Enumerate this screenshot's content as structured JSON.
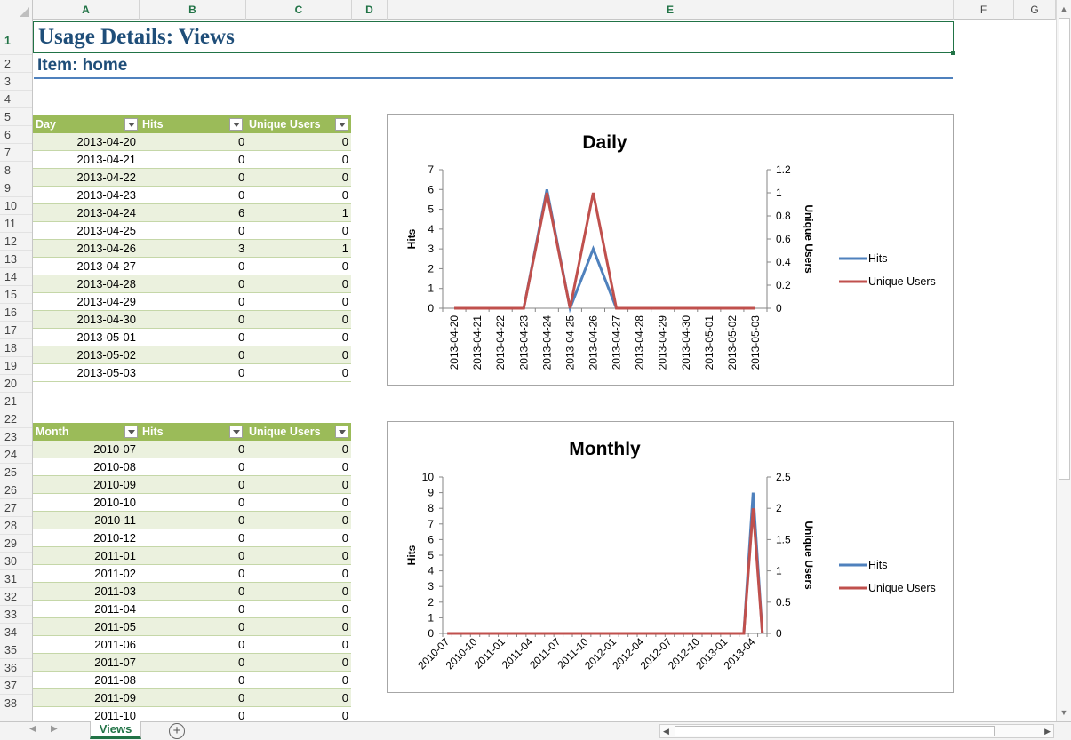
{
  "column_headers": [
    "A",
    "B",
    "C",
    "D",
    "E",
    "F",
    "G"
  ],
  "row_numbers": [
    "1",
    "2",
    "3",
    "4",
    "5",
    "6",
    "7",
    "8",
    "9",
    "10",
    "11",
    "12",
    "13",
    "14",
    "15",
    "16",
    "17",
    "18",
    "19",
    "20",
    "21",
    "22",
    "23",
    "24",
    "25",
    "26",
    "27",
    "28",
    "29",
    "30",
    "31",
    "32",
    "33",
    "34",
    "35",
    "36",
    "37",
    "38"
  ],
  "title": "Usage Details: Views",
  "item": "Item: home",
  "daily_table": {
    "headers": [
      "Day",
      "Hits",
      "Unique Users"
    ],
    "rows": [
      [
        "2013-04-20",
        "0",
        "0"
      ],
      [
        "2013-04-21",
        "0",
        "0"
      ],
      [
        "2013-04-22",
        "0",
        "0"
      ],
      [
        "2013-04-23",
        "0",
        "0"
      ],
      [
        "2013-04-24",
        "6",
        "1"
      ],
      [
        "2013-04-25",
        "0",
        "0"
      ],
      [
        "2013-04-26",
        "3",
        "1"
      ],
      [
        "2013-04-27",
        "0",
        "0"
      ],
      [
        "2013-04-28",
        "0",
        "0"
      ],
      [
        "2013-04-29",
        "0",
        "0"
      ],
      [
        "2013-04-30",
        "0",
        "0"
      ],
      [
        "2013-05-01",
        "0",
        "0"
      ],
      [
        "2013-05-02",
        "0",
        "0"
      ],
      [
        "2013-05-03",
        "0",
        "0"
      ]
    ]
  },
  "monthly_table": {
    "headers": [
      "Month",
      "Hits",
      "Unique Users"
    ],
    "rows": [
      [
        "2010-07",
        "0",
        "0"
      ],
      [
        "2010-08",
        "0",
        "0"
      ],
      [
        "2010-09",
        "0",
        "0"
      ],
      [
        "2010-10",
        "0",
        "0"
      ],
      [
        "2010-11",
        "0",
        "0"
      ],
      [
        "2010-12",
        "0",
        "0"
      ],
      [
        "2011-01",
        "0",
        "0"
      ],
      [
        "2011-02",
        "0",
        "0"
      ],
      [
        "2011-03",
        "0",
        "0"
      ],
      [
        "2011-04",
        "0",
        "0"
      ],
      [
        "2011-05",
        "0",
        "0"
      ],
      [
        "2011-06",
        "0",
        "0"
      ],
      [
        "2011-07",
        "0",
        "0"
      ],
      [
        "2011-08",
        "0",
        "0"
      ],
      [
        "2011-09",
        "0",
        "0"
      ],
      [
        "2011-10",
        "0",
        "0"
      ]
    ]
  },
  "colors": {
    "hits": "#4f81bd",
    "unique_users": "#c0504d",
    "table_header": "#9bbb59",
    "table_band": "#ebf1de",
    "title": "#1f4e79",
    "excel_green": "#217346"
  },
  "chart_data": [
    {
      "type": "line",
      "title": "Daily",
      "x": [
        "2013-04-20",
        "2013-04-21",
        "2013-04-22",
        "2013-04-23",
        "2013-04-24",
        "2013-04-25",
        "2013-04-26",
        "2013-04-27",
        "2013-04-28",
        "2013-04-29",
        "2013-04-30",
        "2013-05-01",
        "2013-05-02",
        "2013-05-03"
      ],
      "x_ticks": [
        "2013-04-20",
        "2013-04-21",
        "2013-04-22",
        "2013-04-23",
        "2013-04-24",
        "2013-04-25",
        "2013-04-26",
        "2013-04-27",
        "2013-04-28",
        "2013-04-29",
        "2013-04-30",
        "2013-05-01",
        "2013-05-02",
        "2013-05-03"
      ],
      "series": [
        {
          "name": "Hits",
          "axis": "left",
          "values": [
            0,
            0,
            0,
            0,
            6,
            0,
            3,
            0,
            0,
            0,
            0,
            0,
            0,
            0
          ]
        },
        {
          "name": "Unique Users",
          "axis": "right",
          "values": [
            0,
            0,
            0,
            0,
            1,
            0,
            1,
            0,
            0,
            0,
            0,
            0,
            0,
            0
          ]
        }
      ],
      "ylabel": "Hits",
      "y2label": "Unique Users",
      "ylim": [
        0,
        7
      ],
      "y2lim": [
        0,
        1.2
      ],
      "yticks": [
        "0",
        "1",
        "2",
        "3",
        "4",
        "5",
        "6",
        "7"
      ],
      "y2ticks": [
        "0",
        "0.2",
        "0.4",
        "0.6",
        "0.8",
        "1",
        "1.2"
      ],
      "legend": "right",
      "grid": false
    },
    {
      "type": "line",
      "title": "Monthly",
      "x": [
        "2010-07",
        "2010-08",
        "2010-09",
        "2010-10",
        "2010-11",
        "2010-12",
        "2011-01",
        "2011-02",
        "2011-03",
        "2011-04",
        "2011-05",
        "2011-06",
        "2011-07",
        "2011-08",
        "2011-09",
        "2011-10",
        "2011-11",
        "2011-12",
        "2012-01",
        "2012-02",
        "2012-03",
        "2012-04",
        "2012-05",
        "2012-06",
        "2012-07",
        "2012-08",
        "2012-09",
        "2012-10",
        "2012-11",
        "2012-12",
        "2013-01",
        "2013-02",
        "2013-03",
        "2013-04",
        "2013-05"
      ],
      "x_ticks": [
        "2010-07",
        "2010-10",
        "2011-01",
        "2011-04",
        "2011-07",
        "2011-10",
        "2012-01",
        "2012-04",
        "2012-07",
        "2012-10",
        "2013-01",
        "2013-04"
      ],
      "series": [
        {
          "name": "Hits",
          "axis": "left",
          "values": [
            0,
            0,
            0,
            0,
            0,
            0,
            0,
            0,
            0,
            0,
            0,
            0,
            0,
            0,
            0,
            0,
            0,
            0,
            0,
            0,
            0,
            0,
            0,
            0,
            0,
            0,
            0,
            0,
            0,
            0,
            0,
            0,
            0,
            9,
            0
          ]
        },
        {
          "name": "Unique Users",
          "axis": "right",
          "values": [
            0,
            0,
            0,
            0,
            0,
            0,
            0,
            0,
            0,
            0,
            0,
            0,
            0,
            0,
            0,
            0,
            0,
            0,
            0,
            0,
            0,
            0,
            0,
            0,
            0,
            0,
            0,
            0,
            0,
            0,
            0,
            0,
            0,
            2,
            0
          ]
        }
      ],
      "ylabel": "Hits",
      "y2label": "Unique Users",
      "ylim": [
        0,
        10
      ],
      "y2lim": [
        0,
        2.5
      ],
      "yticks": [
        "0",
        "1",
        "2",
        "3",
        "4",
        "5",
        "6",
        "7",
        "8",
        "9",
        "10"
      ],
      "y2ticks": [
        "0",
        "0.5",
        "1",
        "1.5",
        "2",
        "2.5"
      ],
      "legend": "right",
      "grid": false
    }
  ],
  "sheet_tab": "Views",
  "add_sheet": "+"
}
